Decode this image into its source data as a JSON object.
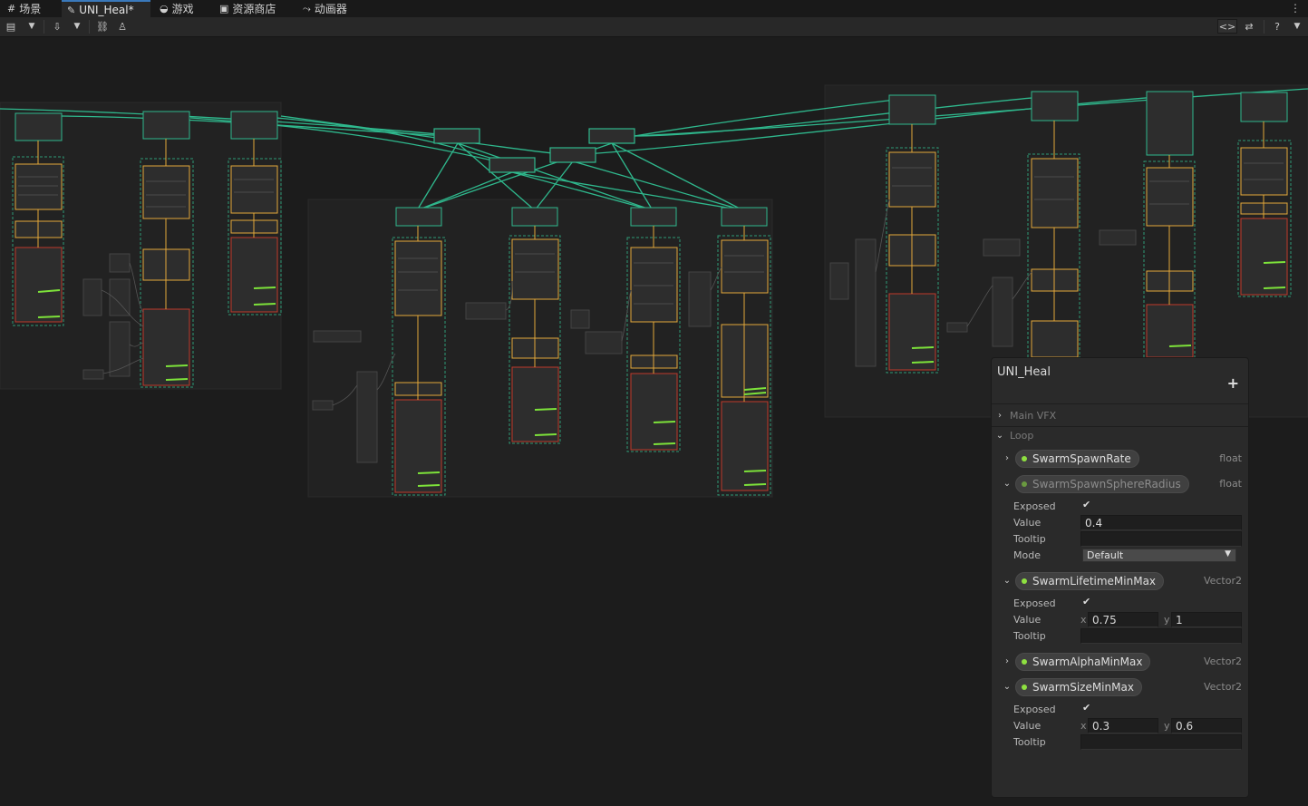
{
  "tabs": [
    {
      "label": "场景",
      "icon": "grid-icon"
    },
    {
      "label": "UNI_Heal*",
      "icon": "vfx-icon"
    },
    {
      "label": "游戏",
      "icon": "gamepad-icon"
    },
    {
      "label": "资源商店",
      "icon": "shopping-bag-icon"
    },
    {
      "label": "动画器",
      "icon": "animator-icon"
    }
  ],
  "toolbar_icons": [
    "save-icon",
    "dropdown-icon",
    "download-icon",
    "dropdown-icon",
    "link-icon",
    "lock-icon",
    "code-brackets-icon",
    "compare-icon",
    "help-icon",
    "dropdown-icon"
  ],
  "colors": {
    "background": "#1c1c1c",
    "edge": "#2fb88d",
    "context_border": "#e3a83a",
    "context_dash": "#2f9a76",
    "property_dot": "#8ee040"
  },
  "blackboard": {
    "title": "UNI_Heal",
    "add_label": "+",
    "categories": [
      {
        "name": "Main VFX",
        "expanded": false
      },
      {
        "name": "Loop",
        "expanded": true
      }
    ],
    "labels": {
      "exposed": "Exposed",
      "value": "Value",
      "tooltip": "Tooltip",
      "mode": "Mode",
      "x": "x",
      "y": "y"
    },
    "properties": [
      {
        "name": "SwarmSpawnRate",
        "type": "float",
        "expanded": false
      },
      {
        "name": "SwarmSpawnSphereRadius",
        "type": "float",
        "expanded": true,
        "exposed": true,
        "value": "0.4",
        "tooltip": "",
        "mode": "Default"
      },
      {
        "name": "SwarmLifetimeMinMax",
        "type": "Vector2",
        "expanded": true,
        "exposed": true,
        "x": "0.75",
        "y": "1",
        "tooltip": ""
      },
      {
        "name": "SwarmAlphaMinMax",
        "type": "Vector2",
        "expanded": false
      },
      {
        "name": "SwarmSizeMinMax",
        "type": "Vector2",
        "expanded": true,
        "exposed": true,
        "x": "0.3",
        "y": "0.6",
        "tooltip": ""
      }
    ]
  }
}
